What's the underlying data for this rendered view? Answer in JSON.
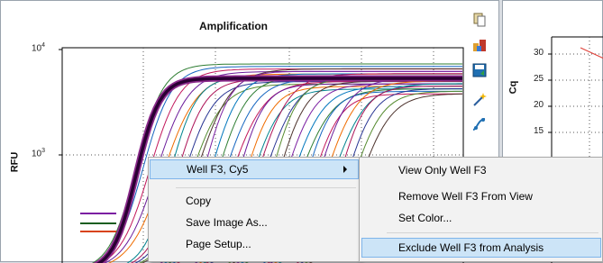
{
  "amplification_panel": {
    "title": "Amplification",
    "ylabel": "RFU",
    "y_ticks": [
      {
        "base": "10",
        "exp": "4"
      },
      {
        "base": "10",
        "exp": "3"
      }
    ]
  },
  "cq_panel": {
    "ylabel": "Cq",
    "y_ticks": [
      "30",
      "25",
      "20",
      "15"
    ]
  },
  "toolbar": {
    "icons": [
      "copy-icon",
      "export-icon",
      "save-icon",
      "settings-wand-icon",
      "curve-fit-icon"
    ]
  },
  "context_menu": {
    "items": [
      {
        "label": "Well F3, Cy5",
        "has_submenu": true,
        "highlighted": true
      },
      {
        "label": "Copy"
      },
      {
        "label": "Save Image As..."
      },
      {
        "label": "Page Setup..."
      }
    ]
  },
  "submenu": {
    "items": [
      {
        "label": "View Only Well F3"
      },
      {
        "label": "Remove Well F3 From View"
      },
      {
        "label": "Set Color..."
      },
      {
        "label": "Exclude Well F3 from Analysis",
        "highlighted": true
      }
    ]
  },
  "colors": {
    "menu_highlight": "#cce4f7",
    "menu_highlight_border": "#7eb4ea",
    "selected_curve": "#2a0033",
    "selected_curve_outline": "#8b2a8b",
    "cq_line": "#e0443c"
  }
}
